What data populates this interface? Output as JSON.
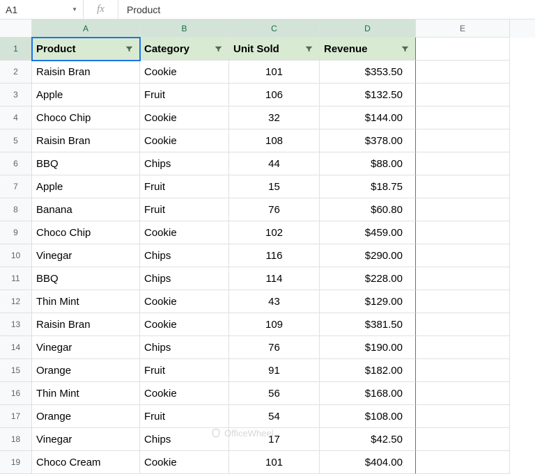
{
  "name_box": "A1",
  "fx_label": "fx",
  "formula_value": "Product",
  "columns": [
    "A",
    "B",
    "C",
    "D",
    "E"
  ],
  "header_row": {
    "num": "1",
    "cells": [
      "Product",
      "Category",
      "Unit Sold",
      "Revenue"
    ]
  },
  "data_rows": [
    {
      "num": "2",
      "product": "Raisin Bran",
      "category": "Cookie",
      "unit": "101",
      "rev": "$353.50"
    },
    {
      "num": "3",
      "product": "Apple",
      "category": "Fruit",
      "unit": "106",
      "rev": "$132.50"
    },
    {
      "num": "4",
      "product": "Choco Chip",
      "category": "Cookie",
      "unit": "32",
      "rev": "$144.00"
    },
    {
      "num": "5",
      "product": "Raisin Bran",
      "category": "Cookie",
      "unit": "108",
      "rev": "$378.00"
    },
    {
      "num": "6",
      "product": "BBQ",
      "category": "Chips",
      "unit": "44",
      "rev": "$88.00"
    },
    {
      "num": "7",
      "product": "Apple",
      "category": "Fruit",
      "unit": "15",
      "rev": "$18.75"
    },
    {
      "num": "8",
      "product": "Banana",
      "category": "Fruit",
      "unit": "76",
      "rev": "$60.80"
    },
    {
      "num": "9",
      "product": "Choco Chip",
      "category": "Cookie",
      "unit": "102",
      "rev": "$459.00"
    },
    {
      "num": "10",
      "product": "Vinegar",
      "category": "Chips",
      "unit": "116",
      "rev": "$290.00"
    },
    {
      "num": "11",
      "product": "BBQ",
      "category": "Chips",
      "unit": "114",
      "rev": "$228.00"
    },
    {
      "num": "12",
      "product": "Thin Mint",
      "category": "Cookie",
      "unit": "43",
      "rev": "$129.00"
    },
    {
      "num": "13",
      "product": "Raisin Bran",
      "category": "Cookie",
      "unit": "109",
      "rev": "$381.50"
    },
    {
      "num": "14",
      "product": "Vinegar",
      "category": "Chips",
      "unit": "76",
      "rev": "$190.00"
    },
    {
      "num": "15",
      "product": "Orange",
      "category": "Fruit",
      "unit": "91",
      "rev": "$182.00"
    },
    {
      "num": "16",
      "product": "Thin Mint",
      "category": "Cookie",
      "unit": "56",
      "rev": "$168.00"
    },
    {
      "num": "17",
      "product": "Orange",
      "category": "Fruit",
      "unit": "54",
      "rev": "$108.00"
    },
    {
      "num": "18",
      "product": "Vinegar",
      "category": "Chips",
      "unit": "17",
      "rev": "$42.50"
    },
    {
      "num": "19",
      "product": "Choco Cream",
      "category": "Cookie",
      "unit": "101",
      "rev": "$404.00"
    }
  ],
  "watermark": "OfficeWheel"
}
